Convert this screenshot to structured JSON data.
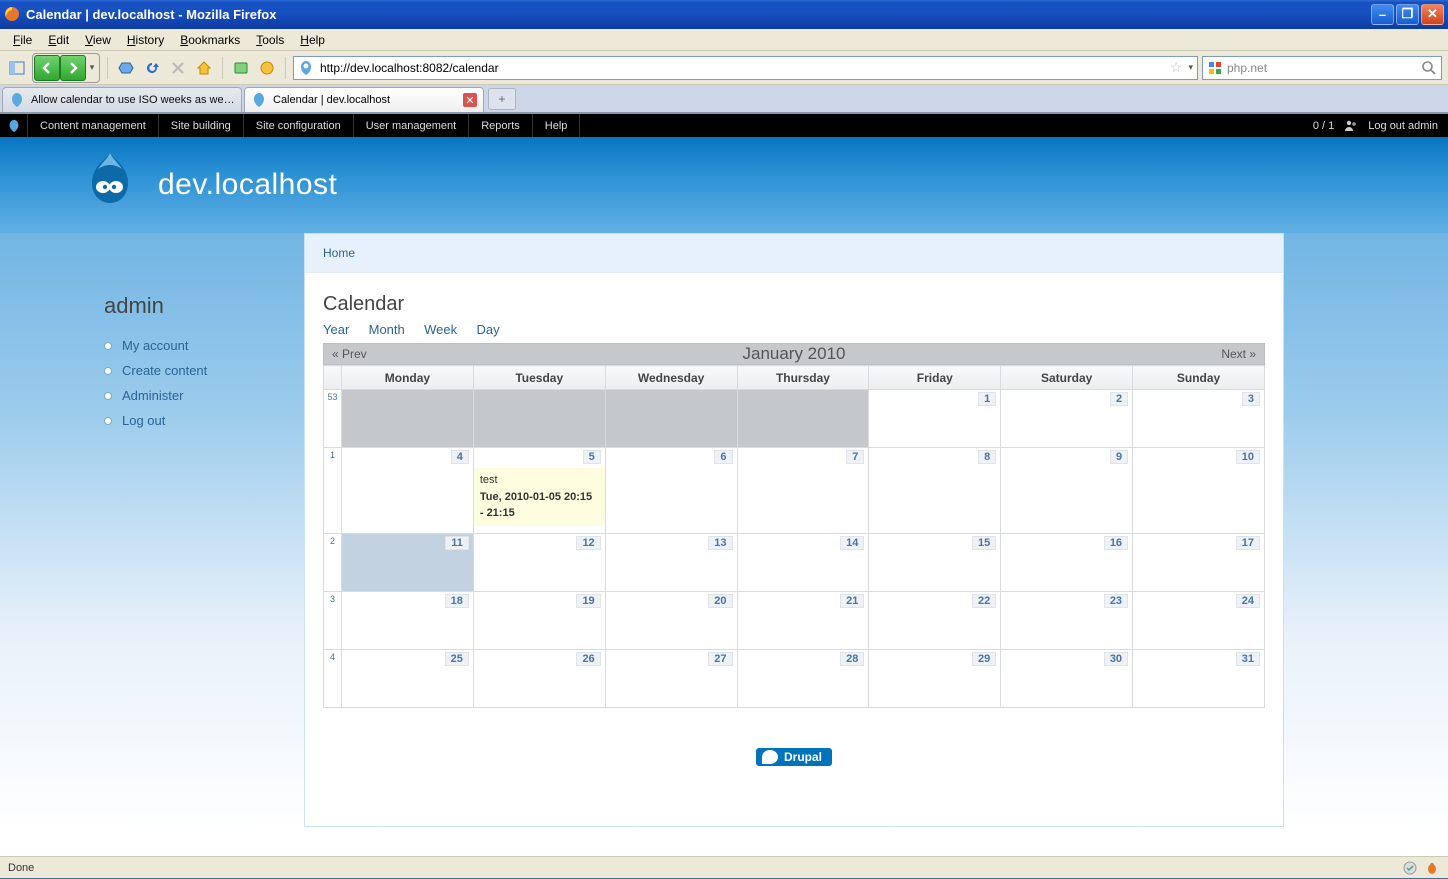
{
  "window": {
    "title": "Calendar | dev.localhost - Mozilla Firefox"
  },
  "menu": [
    "File",
    "Edit",
    "View",
    "History",
    "Bookmarks",
    "Tools",
    "Help"
  ],
  "toolbar": {
    "url": "http://dev.localhost:8082/calendar",
    "search_placeholder": "php.net"
  },
  "tabs": [
    {
      "title": "Allow calendar to use ISO weeks as wel...",
      "active": false
    },
    {
      "title": "Calendar | dev.localhost",
      "active": true
    }
  ],
  "admin_menu": {
    "items": [
      "Content management",
      "Site building",
      "Site configuration",
      "User management",
      "Reports",
      "Help"
    ],
    "counter": "0 / 1",
    "logout": "Log out admin"
  },
  "site": {
    "name": "dev.localhost"
  },
  "breadcrumb": {
    "home": "Home"
  },
  "page": {
    "title": "Calendar",
    "view_tabs": [
      "Year",
      "Month",
      "Week",
      "Day"
    ],
    "prev": "« Prev",
    "next": "Next »",
    "month_title": "January 2010"
  },
  "sidebar": {
    "heading": "admin",
    "links": [
      "My account",
      "Create content",
      "Administer",
      "Log out"
    ]
  },
  "calendar": {
    "days": [
      "Monday",
      "Tuesday",
      "Wednesday",
      "Thursday",
      "Friday",
      "Saturday",
      "Sunday"
    ],
    "rows": [
      {
        "wk": "53",
        "cells": [
          {
            "pad": true
          },
          {
            "pad": true
          },
          {
            "pad": true
          },
          {
            "pad": true
          },
          {
            "d": "1"
          },
          {
            "d": "2"
          },
          {
            "d": "3"
          }
        ]
      },
      {
        "wk": "1",
        "cells": [
          {
            "d": "4"
          },
          {
            "d": "5",
            "event": {
              "title": "test",
              "time": "Tue, 2010-01-05 20:15 - 21:15"
            }
          },
          {
            "d": "6"
          },
          {
            "d": "7"
          },
          {
            "d": "8"
          },
          {
            "d": "9"
          },
          {
            "d": "10"
          }
        ],
        "tall": true
      },
      {
        "wk": "2",
        "cells": [
          {
            "d": "11",
            "today": true
          },
          {
            "d": "12"
          },
          {
            "d": "13"
          },
          {
            "d": "14"
          },
          {
            "d": "15"
          },
          {
            "d": "16"
          },
          {
            "d": "17"
          }
        ]
      },
      {
        "wk": "3",
        "cells": [
          {
            "d": "18"
          },
          {
            "d": "19"
          },
          {
            "d": "20"
          },
          {
            "d": "21"
          },
          {
            "d": "22"
          },
          {
            "d": "23"
          },
          {
            "d": "24"
          }
        ]
      },
      {
        "wk": "4",
        "cells": [
          {
            "d": "25"
          },
          {
            "d": "26"
          },
          {
            "d": "27"
          },
          {
            "d": "28"
          },
          {
            "d": "29"
          },
          {
            "d": "30"
          },
          {
            "d": "31"
          }
        ]
      }
    ]
  },
  "footer": {
    "drupal": "Drupal"
  },
  "status": {
    "text": "Done"
  }
}
